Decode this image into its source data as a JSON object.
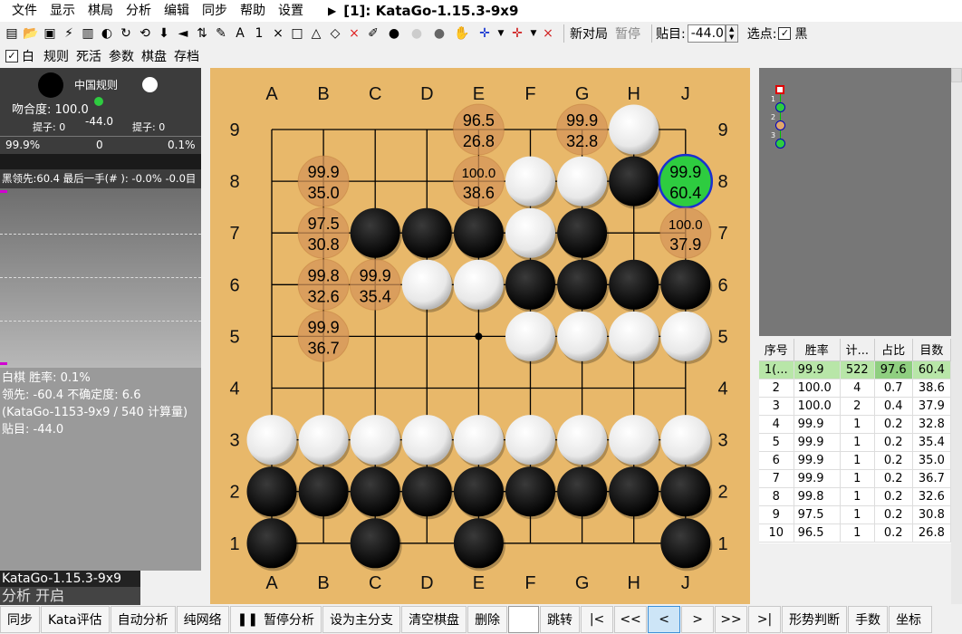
{
  "menu": {
    "items": [
      "文件",
      "显示",
      "棋局",
      "分析",
      "编辑",
      "同步",
      "帮助",
      "设置"
    ],
    "title": "[1]: KataGo-1.15.3-9x9"
  },
  "toolbar2": {
    "white_label": "白",
    "items": [
      "规则",
      "死活",
      "参数",
      "棋盘",
      "存档"
    ]
  },
  "toolbar1": {
    "new_game": "新对局",
    "pause": "暂停",
    "komi_label": "贴目:",
    "komi_value": "-44.0",
    "select_label": "选点:",
    "black_label": "黑"
  },
  "left": {
    "rule": "中国规则",
    "fit": "吻合度: 100.0",
    "capture_black": "提子: 0",
    "capture_white": "提子: 0",
    "score_diff": "-44.0",
    "black_pct": "99.9%",
    "mid": "0",
    "white_pct": "0.1%",
    "lead_line": "黑领先:60.4 最后一手(#  ): -0.0% -0.0目"
  },
  "left_info": {
    "line1": "白棋 胜率: 0.1%",
    "line2": "领先: -60.4 不确定度: 6.6",
    "line3": "(KataGo-1153-9x9 / 540 计算量)",
    "line4": "贴目: -44.0"
  },
  "status": {
    "engine": "KataGo-1.15.3-9x9",
    "analysis": "分析 开启"
  },
  "board": {
    "cols": [
      "A",
      "B",
      "C",
      "D",
      "E",
      "F",
      "G",
      "H",
      "J"
    ],
    "rows": [
      "9",
      "8",
      "7",
      "6",
      "5",
      "4",
      "3",
      "2",
      "1"
    ],
    "black": [
      "H8",
      "C7",
      "D7",
      "E7",
      "G7",
      "F6",
      "G6",
      "H6",
      "J6",
      "A2",
      "B2",
      "C2",
      "D2",
      "E2",
      "F2",
      "G2",
      "H2",
      "J2",
      "A1",
      "C1",
      "E1",
      "J1"
    ],
    "white": [
      "H9",
      "F8",
      "G8",
      "F7",
      "D6",
      "E6",
      "F5",
      "G5",
      "H5",
      "J5",
      "A3",
      "B3",
      "C3",
      "D3",
      "E3",
      "F3",
      "G3",
      "H3",
      "J3"
    ],
    "candidates": [
      {
        "pt": "J8",
        "wr": "99.9",
        "lead": "60.4",
        "best": true
      },
      {
        "pt": "E9",
        "wr": "96.5",
        "lead": "26.8"
      },
      {
        "pt": "G9",
        "wr": "99.9",
        "lead": "32.8"
      },
      {
        "pt": "B8",
        "wr": "99.9",
        "lead": "35.0"
      },
      {
        "pt": "E8",
        "wr": "100.0",
        "lead": "38.6"
      },
      {
        "pt": "B7",
        "wr": "97.5",
        "lead": "30.8"
      },
      {
        "pt": "J7",
        "wr": "100.0",
        "lead": "37.9"
      },
      {
        "pt": "B6",
        "wr": "99.8",
        "lead": "32.6"
      },
      {
        "pt": "C6",
        "wr": "99.9",
        "lead": "35.4"
      },
      {
        "pt": "B5",
        "wr": "99.9",
        "lead": "36.7"
      }
    ]
  },
  "table": {
    "headers": [
      "序号",
      "胜率",
      "计...",
      "占比",
      "目数"
    ],
    "rows": [
      [
        "1(...",
        "99.9",
        "522",
        "97.6",
        "60.4"
      ],
      [
        "2",
        "100.0",
        "4",
        "0.7",
        "38.6"
      ],
      [
        "3",
        "100.0",
        "2",
        "0.4",
        "37.9"
      ],
      [
        "4",
        "99.9",
        "1",
        "0.2",
        "32.8"
      ],
      [
        "5",
        "99.9",
        "1",
        "0.2",
        "35.4"
      ],
      [
        "6",
        "99.9",
        "1",
        "0.2",
        "35.0"
      ],
      [
        "7",
        "99.9",
        "1",
        "0.2",
        "36.7"
      ],
      [
        "8",
        "99.8",
        "1",
        "0.2",
        "32.6"
      ],
      [
        "9",
        "97.5",
        "1",
        "0.2",
        "30.8"
      ],
      [
        "10",
        "96.5",
        "1",
        "0.2",
        "26.8"
      ]
    ]
  },
  "bottom": {
    "buttons": [
      "同步",
      "Kata评估",
      "自动分析",
      "纯网络",
      "暂停分析",
      "设为主分支",
      "清空棋盘",
      "删除",
      "",
      "跳转",
      "|<",
      "<<",
      "<",
      ">",
      ">>",
      ">|",
      "形势判断",
      "手数",
      "坐标"
    ]
  },
  "colors": {
    "board": "#e8b86a",
    "best": "#2ecc40",
    "candidate": "#e0a76a"
  }
}
